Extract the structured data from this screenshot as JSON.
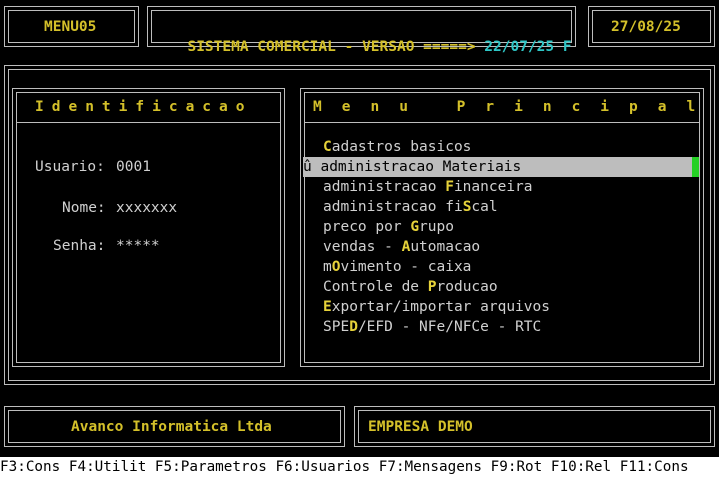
{
  "header": {
    "menu_id": "MENU05",
    "title": "SISTEMA COMERCIAL - VERSAO =====>",
    "version": "22/07/25 F",
    "date": "27/08/25"
  },
  "identificacao": {
    "title": "Identificacao",
    "usuario_label": "Usuario:",
    "usuario_value": "0001",
    "nome_label": "Nome:",
    "nome_value": "xxxxxxx",
    "senha_label": "Senha:",
    "senha_value": "*****"
  },
  "menu": {
    "title": "Menu Principal",
    "selected_marker": "û",
    "items": [
      {
        "pre": "",
        "hot": "C",
        "post": "adastros basicos"
      },
      {
        "pre": "",
        "hot": "",
        "post": "administracao Materiais"
      },
      {
        "pre": "administracao ",
        "hot": "F",
        "post": "inanceira"
      },
      {
        "pre": "administracao fi",
        "hot": "S",
        "post": "cal"
      },
      {
        "pre": "preco por ",
        "hot": "G",
        "post": "rupo"
      },
      {
        "pre": "vendas - ",
        "hot": "A",
        "post": "utomacao"
      },
      {
        "pre": "m",
        "hot": "O",
        "post": "vimento - caixa"
      },
      {
        "pre": "Controle de ",
        "hot": "P",
        "post": "roducao"
      },
      {
        "pre": "",
        "hot": "E",
        "post": "xportar/importar arquivos"
      },
      {
        "pre": "SPE",
        "hot": "D",
        "post": "/EFD - NFe/NFCe - RTC"
      }
    ]
  },
  "footer": {
    "company": "Avanco Informatica Ltda",
    "empresa": "EMPRESA DEMO"
  },
  "fkeys": "F3:Cons F4:Utilit F5:Parametros F6:Usuarios F7:Mensagens F9:Rot F10:Rel F11:Cons"
}
